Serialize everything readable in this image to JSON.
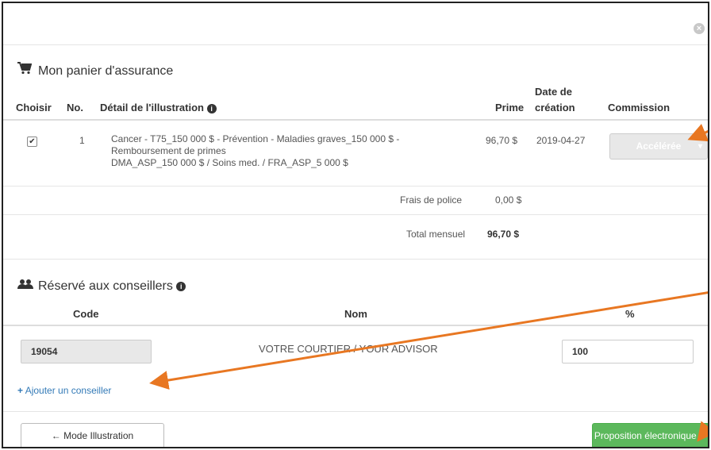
{
  "cart": {
    "title": "Mon panier d'assurance",
    "headers": {
      "choisir": "Choisir",
      "no": "No.",
      "detail": "Détail de l'illustration",
      "prime": "Prime",
      "date_line1": "Date de",
      "date_line2": "création",
      "commission": "Commission"
    },
    "row": {
      "no": "1",
      "detail_line1": "Cancer - T75_150 000 $ - Prévention - Maladies graves_150 000 $ -",
      "detail_line2": "Remboursement de primes",
      "detail_line3": "DMA_ASP_150 000 $ / Soins med. / FRA_ASP_5 000 $",
      "prime": "96,70 $",
      "date": "2019-04-27",
      "commission_button": "Accélérée"
    },
    "frais_label": "Frais de police",
    "frais_value": "0,00 $",
    "total_label": "Total mensuel",
    "total_value": "96,70 $"
  },
  "advisors": {
    "title": "Réservé aux conseillers",
    "headers": {
      "code": "Code",
      "nom": "Nom",
      "pct": "%"
    },
    "row": {
      "code": "19054",
      "nom": "VOTRE COURTIER / YOUR ADVISOR",
      "pct": "100"
    },
    "add_link": "Ajouter un conseiller"
  },
  "footer": {
    "back_button": "Mode Illustration",
    "submit_button": "Proposition électronique"
  },
  "colors": {
    "accent": "#5cb85c",
    "link": "#337ab7",
    "arrow": "#e87722"
  }
}
